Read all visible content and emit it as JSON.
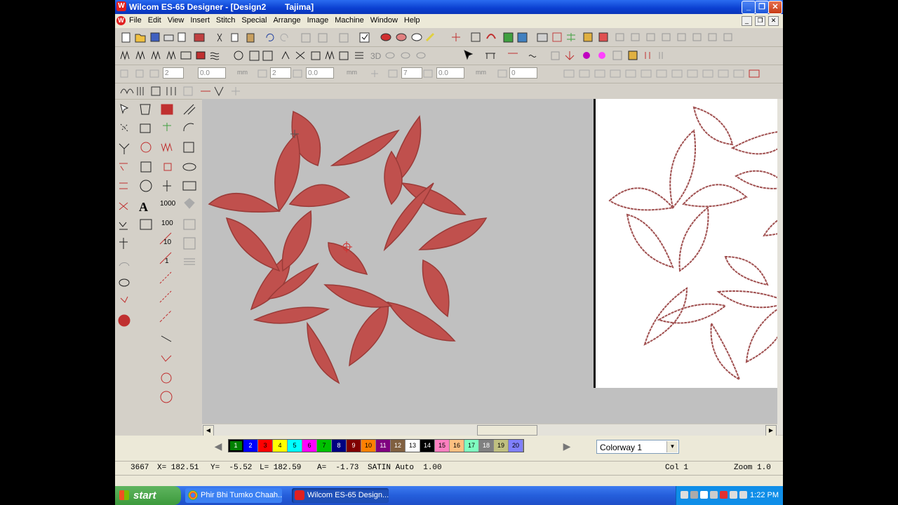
{
  "window": {
    "title": "Wilcom ES-65 Designer - [Design2        Tajima]",
    "app_icon": "W",
    "buttons": [
      "minimize-icon",
      "restore-icon",
      "close-icon"
    ]
  },
  "menu": {
    "items": [
      "File",
      "Edit",
      "View",
      "Insert",
      "Stitch",
      "Special",
      "Arrange",
      "Image",
      "Machine",
      "Window",
      "Help"
    ]
  },
  "toolbar3": {
    "spin1": "2",
    "spin2": "0.0",
    "unit1": "mm",
    "spin3": "2",
    "spin4": "0.0",
    "unit2": "mm",
    "spin5": "7",
    "spin6": "0.0",
    "unit3": "mm",
    "spin7": "0"
  },
  "lefttools": {
    "labels": [
      "1000",
      "100",
      "10",
      "1"
    ],
    "text_tool": "A"
  },
  "canvas": {
    "background": "#c0c0c0",
    "embroidery_color": "#c0504d",
    "reference_outline_color": "#a05050"
  },
  "palette": {
    "swatches": [
      {
        "label": "1",
        "color": "#008000"
      },
      {
        "label": "2",
        "color": "#0000ff"
      },
      {
        "label": "3",
        "color": "#ff0000"
      },
      {
        "label": "4",
        "color": "#ffff00"
      },
      {
        "label": "5",
        "color": "#00ffff"
      },
      {
        "label": "6",
        "color": "#ff00ff"
      },
      {
        "label": "7",
        "color": "#00c000"
      },
      {
        "label": "8",
        "color": "#000080"
      },
      {
        "label": "9",
        "color": "#800000"
      },
      {
        "label": "10",
        "color": "#ff8000"
      },
      {
        "label": "11",
        "color": "#800080"
      },
      {
        "label": "12",
        "color": "#806040"
      },
      {
        "label": "13",
        "color": "#ffffff"
      },
      {
        "label": "14",
        "color": "#000000"
      },
      {
        "label": "15",
        "color": "#ff80c0"
      },
      {
        "label": "16",
        "color": "#ffc080"
      },
      {
        "label": "17",
        "color": "#80ffc0"
      },
      {
        "label": "18",
        "color": "#808080"
      },
      {
        "label": "19",
        "color": "#c0c080"
      },
      {
        "label": "20",
        "color": "#8080ff"
      }
    ],
    "colorway": "Colorway 1"
  },
  "status": {
    "stitch": "3667",
    "x": "X= 182.51",
    "y": "Y=  -5.52",
    "l": "L= 182.59",
    "a": "A=  -1.73",
    "type": "SATIN Auto  1.00",
    "col": "Col 1",
    "zoom": "Zoom 1.0"
  },
  "taskbar": {
    "start": "start",
    "tasks": [
      "Phir Bhi Tumko Chaah...",
      "Wilcom ES-65 Design..."
    ],
    "clock": "1:22 PM"
  }
}
